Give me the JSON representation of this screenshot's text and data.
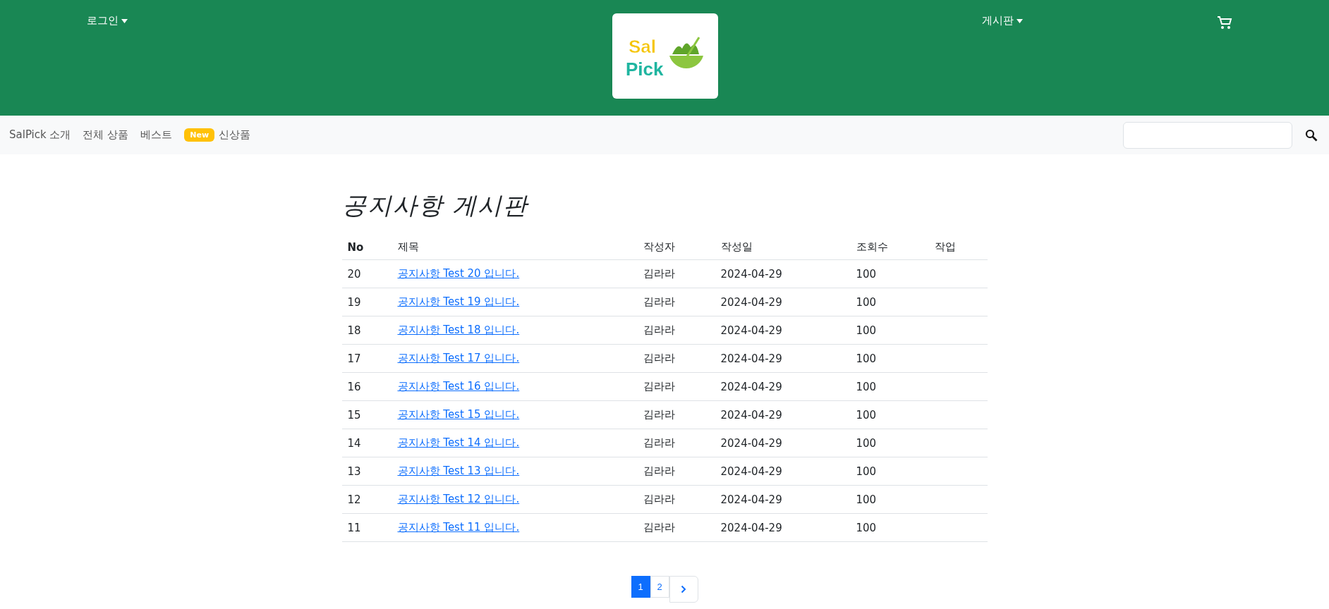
{
  "header": {
    "menus": [
      {
        "label": "로그인"
      },
      {
        "label": "게시판"
      }
    ],
    "logo": {
      "line_1": "Sal",
      "line_2": "Pick"
    }
  },
  "nav": {
    "items": [
      {
        "label": "SalPick 소개"
      },
      {
        "label": "전체 상품"
      },
      {
        "label": "베스트"
      },
      {
        "label": "신상품",
        "badge": "New"
      }
    ]
  },
  "board": {
    "title": "공지사항 게시판",
    "columns": [
      "No",
      "제목",
      "작성자",
      "작성일",
      "조회수",
      "작업"
    ],
    "rows": [
      {
        "no": "20",
        "title": "공지사항 Test 20 입니다.",
        "author": "김라라",
        "date": "2024-04-29",
        "views": "100"
      },
      {
        "no": "19",
        "title": "공지사항 Test 19 입니다.",
        "author": "김라라",
        "date": "2024-04-29",
        "views": "100"
      },
      {
        "no": "18",
        "title": "공지사항 Test 18 입니다.",
        "author": "김라라",
        "date": "2024-04-29",
        "views": "100"
      },
      {
        "no": "17",
        "title": "공지사항 Test 17 입니다.",
        "author": "김라라",
        "date": "2024-04-29",
        "views": "100"
      },
      {
        "no": "16",
        "title": "공지사항 Test 16 입니다.",
        "author": "김라라",
        "date": "2024-04-29",
        "views": "100"
      },
      {
        "no": "15",
        "title": "공지사항 Test 15 입니다.",
        "author": "김라라",
        "date": "2024-04-29",
        "views": "100"
      },
      {
        "no": "14",
        "title": "공지사항 Test 14 입니다.",
        "author": "김라라",
        "date": "2024-04-29",
        "views": "100"
      },
      {
        "no": "13",
        "title": "공지사항 Test 13 입니다.",
        "author": "김라라",
        "date": "2024-04-29",
        "views": "100"
      },
      {
        "no": "12",
        "title": "공지사항 Test 12 입니다.",
        "author": "김라라",
        "date": "2024-04-29",
        "views": "100"
      },
      {
        "no": "11",
        "title": "공지사항 Test 11 입니다.",
        "author": "김라라",
        "date": "2024-04-29",
        "views": "100"
      }
    ]
  },
  "pagination": {
    "pages": [
      {
        "label": "1",
        "selected": true
      },
      {
        "label": "2",
        "selected": false
      }
    ]
  }
}
